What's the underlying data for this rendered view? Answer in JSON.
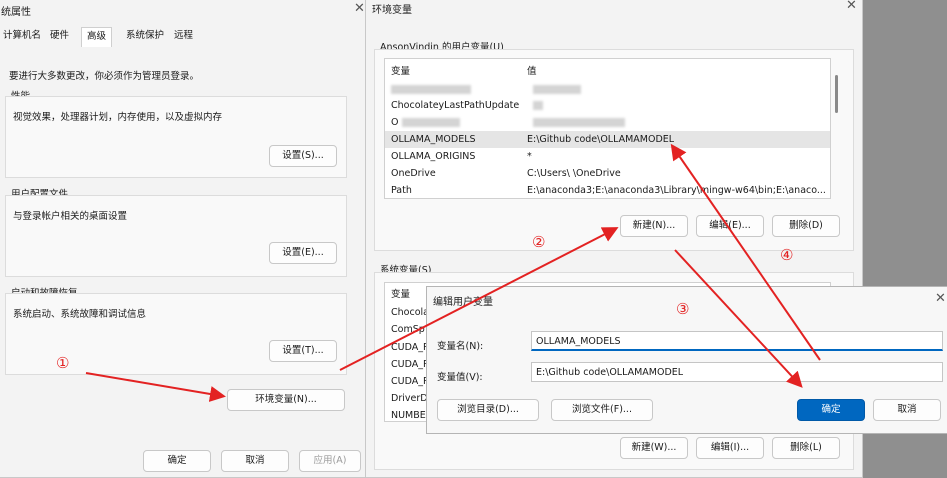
{
  "sysprops": {
    "title": "统属性",
    "tabs": [
      {
        "label": "计算机名",
        "active": false
      },
      {
        "label": "硬件",
        "active": false
      },
      {
        "label": "高级",
        "active": true
      },
      {
        "label": "系统保护",
        "active": false
      },
      {
        "label": "远程",
        "active": false
      }
    ],
    "note": "要进行大多数更改，你必须作为管理员登录。",
    "perf_title": "性能",
    "perf_desc": "视觉效果，处理器计划，内存使用，以及虚拟内存",
    "perf_btn": "设置(S)...",
    "profile_title": "用户配置文件",
    "profile_desc": "与登录帐户相关的桌面设置",
    "profile_btn": "设置(E)...",
    "startup_title": "启动和故障恢复",
    "startup_desc": "系统启动、系统故障和调试信息",
    "startup_btn": "设置(T)...",
    "env_btn": "环境变量(N)...",
    "ok": "确定",
    "cancel": "取消",
    "apply": "应用(A)"
  },
  "envvars": {
    "title": "环境变量",
    "user_group": "AnsonVindin 的用户变量(U)",
    "col_var": "变量",
    "col_val": "值",
    "user_vars": [
      {
        "name": "ChocolateyLastPathUpdate",
        "value": "",
        "blurred": true
      },
      {
        "name": "O",
        "value": "",
        "blurred": true
      },
      {
        "name": "OLLAMA_MODELS",
        "value": "E:\\Github code\\OLLAMAMODEL",
        "selected": true
      },
      {
        "name": "OLLAMA_ORIGINS",
        "value": "*"
      },
      {
        "name": "OneDrive",
        "value": "C:\\Users\\ \\OneDrive"
      },
      {
        "name": "Path",
        "value": "E:\\anaconda3;E:\\anaconda3\\Library\\mingw-w64\\bin;E:\\anaco..."
      }
    ],
    "user_new": "新建(N)...",
    "user_edit": "编辑(E)...",
    "user_delete": "删除(D)",
    "sys_group": "系统变量(S)",
    "sys_vars": [
      "Chocola",
      "ComSp",
      "CUDA_P",
      "CUDA_P",
      "CUDA_P",
      "DriverD",
      "NUMBE"
    ],
    "sys_new": "新建(W)...",
    "sys_edit": "编辑(I)...",
    "sys_delete": "删除(L)"
  },
  "edit_dialog": {
    "title": "编辑用户变量",
    "name_label": "变量名(N):",
    "name_value": "OLLAMA_MODELS",
    "value_label": "变量值(V):",
    "value_value": "E:\\Github code\\OLLAMAMODEL",
    "browse_dir": "浏览目录(D)...",
    "browse_file": "浏览文件(F)...",
    "ok": "确定",
    "cancel": "取消"
  },
  "annotations": [
    "①",
    "②",
    "③",
    "④"
  ],
  "annotation_color": "#e32222"
}
